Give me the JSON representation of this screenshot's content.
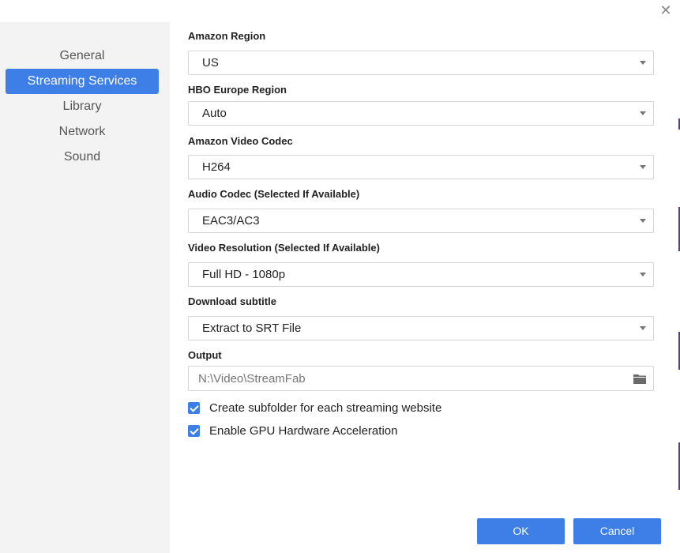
{
  "window": {
    "close_glyph": "✕"
  },
  "sidebar": {
    "items": [
      {
        "label": "General",
        "active": false
      },
      {
        "label": "Streaming Services",
        "active": true
      },
      {
        "label": "Library",
        "active": false
      },
      {
        "label": "Network",
        "active": false
      },
      {
        "label": "Sound",
        "active": false
      }
    ]
  },
  "settings": {
    "amazon_region": {
      "label": "Amazon Region",
      "value": "US"
    },
    "hbo_europe_region": {
      "label": "HBO Europe Region",
      "value": "Auto"
    },
    "amazon_video_codec": {
      "label": "Amazon Video Codec",
      "value": "H264"
    },
    "audio_codec": {
      "label": "Audio Codec (Selected If Available)",
      "value": "EAC3/AC3"
    },
    "video_resolution": {
      "label": "Video Resolution (Selected If Available)",
      "value": "Full HD - 1080p"
    },
    "download_subtitle": {
      "label": "Download subtitle",
      "value": "Extract to SRT File"
    },
    "output": {
      "label": "Output",
      "placeholder": "N:\\Video\\StreamFab",
      "icon": "folder-icon"
    },
    "create_subfolder": {
      "label": "Create subfolder for each streaming website",
      "checked": true
    },
    "gpu_acceleration": {
      "label": "Enable GPU Hardware Acceleration",
      "checked": true
    }
  },
  "buttons": {
    "ok": "OK",
    "cancel": "Cancel"
  },
  "colors": {
    "accent": "#3d7fe6",
    "sidebar_bg": "#f3f3f3"
  }
}
